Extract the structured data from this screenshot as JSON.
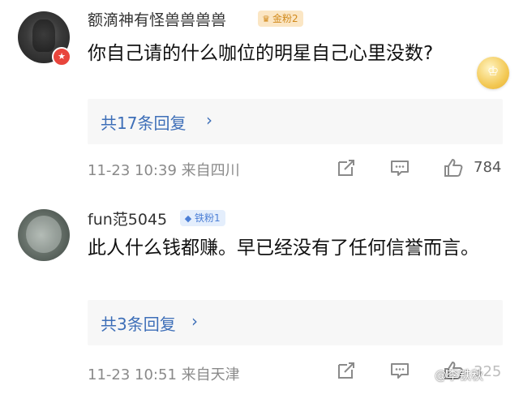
{
  "comments": [
    {
      "username": "额滴神有怪兽兽兽兽",
      "badge_label": "金粉2",
      "text": "你自己请的什么咖位的明星自己心里没数?",
      "replies_label": "共17条回复",
      "timestamp": "11-23 10:39",
      "location": "来自四川",
      "like_count": "784"
    },
    {
      "username": "fun范5045",
      "badge_label": "铁粉1",
      "text": "此人什么钱都赚。早已经没有了任何信誉而言。",
      "replies_label": "共3条回复",
      "timestamp": "11-23 10:51",
      "location": "来自天津",
      "like_count": "325"
    }
  ],
  "watermark": "@李铁秋",
  "colors": {
    "link_blue": "#3e6fb8",
    "gold_badge": "#d18a1c",
    "iron_badge": "#4c7fd6",
    "verified_red": "#e8453c"
  },
  "icons": [
    "share-icon",
    "comment-icon",
    "like-icon",
    "chevron-right-icon",
    "verified-icon",
    "medal-icon"
  ]
}
